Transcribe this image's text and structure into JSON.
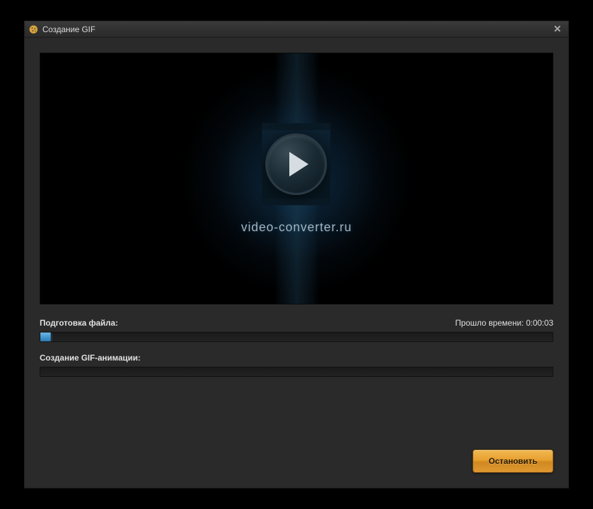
{
  "titlebar": {
    "title": "Создание GIF"
  },
  "preview": {
    "brand": "video-converter.ru"
  },
  "progress": {
    "prepare": {
      "label": "Подготовка файла:",
      "elapsed_label": "Прошло времени:",
      "elapsed_value": "0:00:03",
      "percent": 2
    },
    "create": {
      "label": "Создание GIF-анимации:",
      "percent": 0
    }
  },
  "buttons": {
    "stop": "Остановить"
  }
}
